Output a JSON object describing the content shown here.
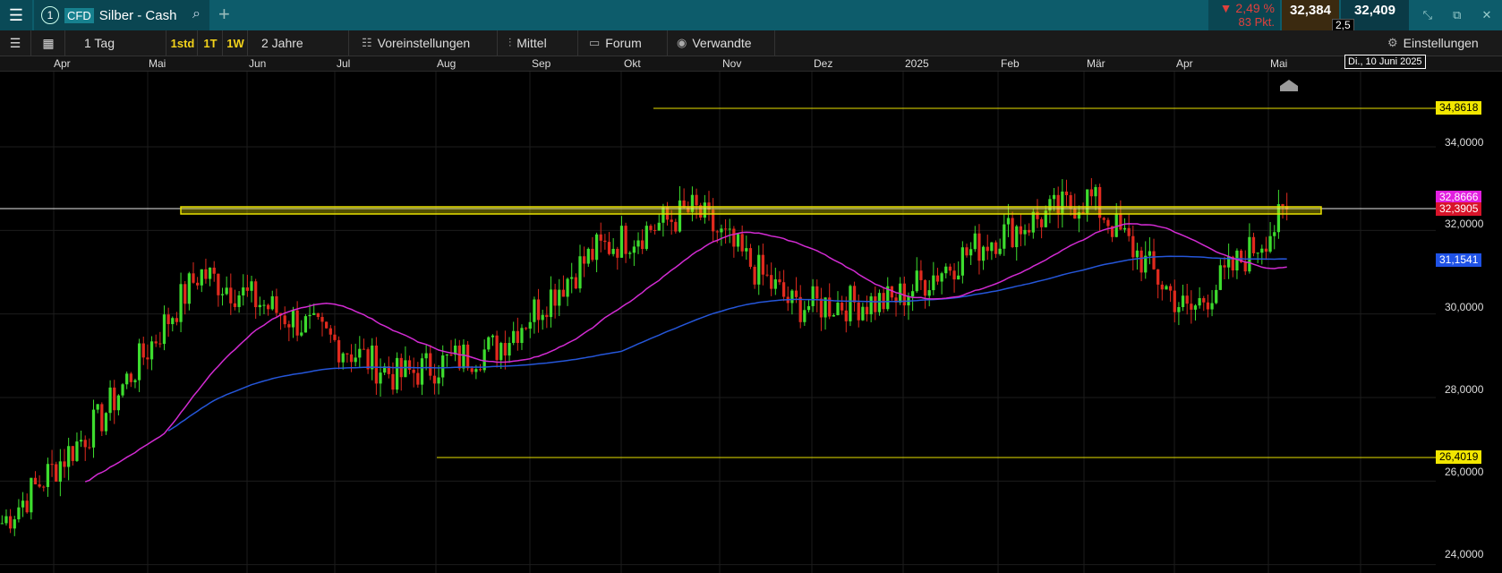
{
  "tab": {
    "number": "1",
    "cfd": "CFD",
    "title": "Silber - Cash"
  },
  "quote": {
    "change_pct": "▼ 2,49 %",
    "change_pts": "83 Pkt.",
    "bid": "32,384",
    "ask": "32,409",
    "spread": "2,5"
  },
  "toolbar": {
    "period": "1 Tag",
    "btn_1std": "1std",
    "btn_1t": "1T",
    "btn_1w": "1W",
    "range": "2 Jahre",
    "presets": "Voreinstellungen",
    "indicators": "Mittel",
    "forum": "Forum",
    "related": "Verwandte",
    "settings": "Einstellungen"
  },
  "months": [
    "Apr",
    "Mai",
    "Jun",
    "Jul",
    "Aug",
    "Sep",
    "Okt",
    "Nov",
    "Dez",
    "2025",
    "Feb",
    "Mär",
    "Apr",
    "Mai"
  ],
  "date_flag": "Di., 10 Juni 2025",
  "y_ticks": [
    "34,0000",
    "32,0000",
    "30,0000",
    "28,0000",
    "26,0000",
    "24,0000"
  ],
  "price_tags": {
    "resistance": "34,8618",
    "support": "26,4019",
    "magenta": "32,8666",
    "current": "32,3905",
    "blue": "31,1541"
  },
  "colors": {
    "up": "#3ddc2e",
    "down": "#e02a1e",
    "ma_short": "#d22bd2",
    "ma_long": "#2556d9",
    "levels": "#e8e000"
  },
  "chart_data": {
    "type": "line",
    "title": "Silber - Cash",
    "x": [
      "Apr",
      "Mai",
      "Jun",
      "Jul",
      "Aug",
      "Sep",
      "Okt",
      "Nov",
      "Dez",
      "2025",
      "Feb",
      "Mär",
      "Apr",
      "Mai"
    ],
    "series": [
      {
        "values": [
          25.0,
          27.5,
          31.0,
          29.8,
          28.5,
          29.2,
          31.5,
          32.5,
          30.2,
          30.3,
          31.8,
          32.8,
          30.0,
          32.4
        ]
      }
    ],
    "ylim": [
      23.8,
      35.8
    ]
  }
}
